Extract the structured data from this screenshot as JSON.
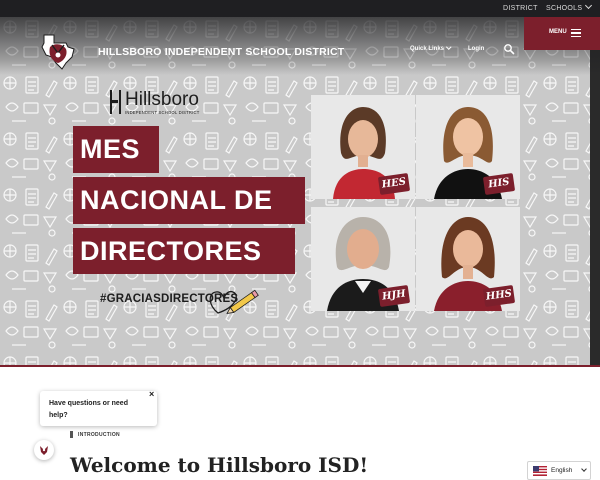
{
  "topbar": {
    "district": "DISTRICT",
    "schools": "SCHOOLS"
  },
  "header": {
    "district_name": "HILLSBORO INDEPENDENT SCHOOL DISTRICT",
    "quick_links": "Quick Links",
    "login": "Login",
    "menu": "MENU"
  },
  "hero": {
    "logo_word": "Hillsboro",
    "logo_sub": "INDEPENDENT SCHOOL DISTRICT",
    "title_lines": [
      "MES",
      "NACIONAL DE",
      "DIRECTORES"
    ],
    "hashtag": "#GRACIASDIRECTORES",
    "photos": [
      {
        "badge": "HES"
      },
      {
        "badge": "HIS"
      },
      {
        "badge": "HJH"
      },
      {
        "badge": "HHS"
      }
    ]
  },
  "chat": {
    "message": "Have questions or need help?",
    "close": "×"
  },
  "intro": {
    "label": "INTRODUCTION",
    "heading": "Welcome to Hillsboro ISD!"
  },
  "language": {
    "label": "English"
  },
  "colors": {
    "brand": "#7c1f2c",
    "topbar": "#1f1f22"
  }
}
